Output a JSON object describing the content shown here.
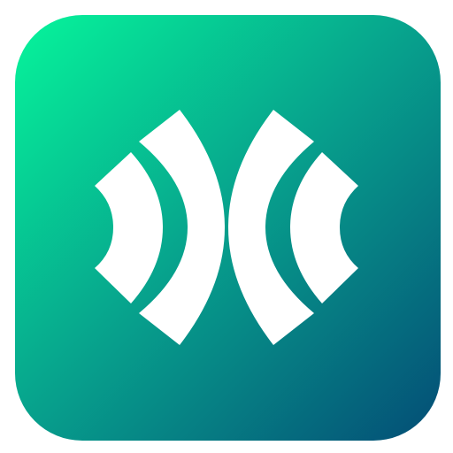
{
  "icon": {
    "name": "app-icon",
    "glyph": "twin-crescent-arcs-logo",
    "colors": {
      "gradient_start": "#06F59B",
      "gradient_mid": "#079F8C",
      "gradient_end": "#044D76",
      "glyph": "#FFFFFF",
      "background": "#FFFFFF"
    }
  }
}
